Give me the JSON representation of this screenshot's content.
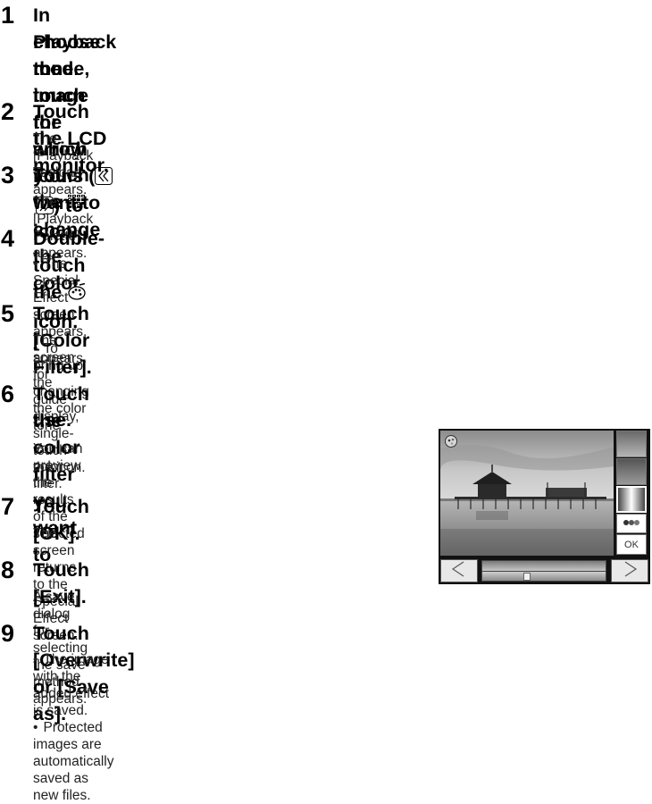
{
  "steps": [
    {
      "num": "1",
      "title_pre": "In Playback mode, touch the arrow icons (",
      "title_post": ") to",
      "title_line2": "choose the image for which you want to change the color",
      "title_line3": "tone."
    },
    {
      "num": "2",
      "title": "Touch the LCD monitor.",
      "desc": "The [Playback Toolbar] appears."
    },
    {
      "num": "3",
      "title_pre": "Touch the ",
      "title_post": " icon.",
      "icon": "playback-palette-icon",
      "desc": "The [Playback Palette] appears."
    },
    {
      "num": "4",
      "title_pre": "Double-touch the ",
      "title_post": " icon.",
      "icon": "special-effect-palette-icon",
      "bullets": [
        "The Special Effect screen appears.",
        "To bring up the guide display, single-touch the icon."
      ]
    },
    {
      "num": "5",
      "title": "Touch [Color Filter].",
      "desc_line1": "The screen for changing the color tone",
      "desc_line2": "appears."
    },
    {
      "num": "6",
      "title_line1": "Touch the color filter you want to",
      "title_line2": "use.",
      "desc_line1": "You can preview the results of the selected",
      "desc_line2": "color filter."
    },
    {
      "num": "7",
      "title": "Touch [OK].",
      "desc": "The screen returns to the Special Effect screen."
    },
    {
      "num": "8",
      "title": "Touch [Exit].",
      "desc": "A save dialog for selecting the save method appears."
    },
    {
      "num": "9",
      "title": "Touch [Overwrite] or [Save as].",
      "bullets": [
        "The image with the added effect is saved.",
        "Protected images are automatically saved as new files."
      ]
    }
  ],
  "camera": {
    "ok_label": "OK",
    "icons": [
      "special-effect-icon",
      "left-arrow-icon",
      "right-arrow-icon",
      "filter-icon"
    ],
    "filter_slider_position": 0.35
  }
}
